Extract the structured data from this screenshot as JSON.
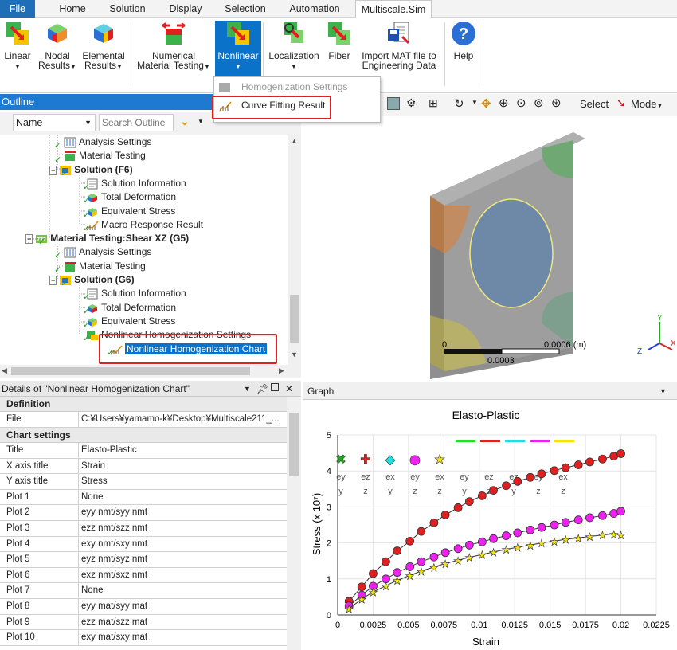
{
  "ribbon_tabs": [
    "File",
    "Home",
    "Solution",
    "Display",
    "Selection",
    "Automation",
    "Multiscale.Sim"
  ],
  "ribbon_buttons": {
    "linear": "Linear",
    "nodal_1": "Nodal",
    "nodal_2": "Results",
    "elemental_1": "Elemental",
    "elemental_2": "Results",
    "numerical_1": "Numerical",
    "numerical_2": "Material Testing",
    "nonlinear": "Nonlinear",
    "localization": "Localization",
    "fiber": "Fiber",
    "import_1": "Import MAT file to",
    "import_2": "Engineering Data",
    "help": "Help"
  },
  "dropdown": {
    "item1": "Homogenization Settings",
    "item2": "Curve Fitting Result"
  },
  "outline": {
    "title": "Outline",
    "name_label": "Name",
    "search_placeholder": "Search Outline",
    "tree": [
      "Analysis Settings",
      "Material Testing",
      "Solution (F6)",
      "Solution Information",
      "Total Deformation",
      "Equivalent Stress",
      "Macro Response Result",
      "Material Testing:Shear XZ (G5)",
      "Analysis Settings",
      "Material Testing",
      "Solution (G6)",
      "Solution Information",
      "Total Deformation",
      "Equivalent Stress",
      "Nonlinear Homogenization Settings",
      "Nonlinear Homogenization Chart"
    ]
  },
  "details": {
    "title": "Details of \"Nonlinear Homogenization Chart\"",
    "section_definition": "Definition",
    "file_key": "File",
    "file_value": "C:¥Users¥yamamo-k¥Desktop¥Multiscale211_...",
    "section_chart": "Chart settings",
    "rows": [
      {
        "k": "Title",
        "v": "Elasto-Plastic"
      },
      {
        "k": "X axis title",
        "v": "Strain"
      },
      {
        "k": "Y axis title",
        "v": "Stress"
      },
      {
        "k": "Plot 1",
        "v": "None"
      },
      {
        "k": "Plot 2",
        "v": "eyy nmt/syy nmt"
      },
      {
        "k": "Plot 3",
        "v": "ezz nmt/szz nmt"
      },
      {
        "k": "Plot 4",
        "v": "exy nmt/sxy nmt"
      },
      {
        "k": "Plot 5",
        "v": "eyz nmt/syz nmt"
      },
      {
        "k": "Plot 6",
        "v": "exz nmt/sxz nmt"
      },
      {
        "k": "Plot 7",
        "v": "None"
      },
      {
        "k": "Plot 8",
        "v": "eyy mat/syy mat"
      },
      {
        "k": "Plot 9",
        "v": "ezz mat/szz mat"
      },
      {
        "k": "Plot 10",
        "v": "exy mat/sxy mat"
      }
    ]
  },
  "viewport": {
    "select_label": "Select",
    "mode_label": "Mode",
    "scale_max": "0.0006 (m)",
    "scale_mid": "0.0003",
    "scale_zero": "0",
    "axis_x": "X",
    "axis_y": "Y",
    "axis_z": "Z"
  },
  "graph": {
    "panel_title": "Graph",
    "legend_labels": [
      "ey",
      "ez",
      "ex",
      "ey",
      "ex",
      "ey",
      "ez",
      "ez",
      "ey",
      "ex"
    ],
    "legend_labels_2": [
      "y",
      "z",
      "y",
      "z",
      "z",
      "y",
      "z",
      "y",
      "z",
      "z"
    ]
  },
  "chart_data": {
    "type": "scatter",
    "title": "Elasto-Plastic",
    "xlabel": "Strain",
    "ylabel": "Stress (x 10⁷)",
    "xlim": [
      0,
      0.0225
    ],
    "ylim": [
      0,
      5
    ],
    "xticks": [
      "0",
      "0.0025",
      "0.005",
      "0.0075",
      "0.01",
      "0.0125",
      "0.015",
      "0.0175",
      "0.02",
      "0.0225"
    ],
    "yticks": [
      "0",
      "1",
      "2",
      "3",
      "4",
      "5"
    ],
    "grid": true,
    "series": [
      {
        "marker": "circle",
        "color": "#e02020",
        "x": [
          0.0008,
          0.0017,
          0.0025,
          0.0034,
          0.0042,
          0.0051,
          0.0059,
          0.0068,
          0.0076,
          0.0085,
          0.0093,
          0.0102,
          0.011,
          0.0119,
          0.0127,
          0.0136,
          0.0144,
          0.0153,
          0.0161,
          0.017,
          0.0178,
          0.0187,
          0.0195,
          0.02
        ],
        "y": [
          0.38,
          0.78,
          1.15,
          1.48,
          1.78,
          2.05,
          2.32,
          2.56,
          2.78,
          2.98,
          3.15,
          3.31,
          3.46,
          3.59,
          3.71,
          3.82,
          3.92,
          4.01,
          4.09,
          4.17,
          4.25,
          4.33,
          4.41,
          4.48
        ]
      },
      {
        "marker": "circle",
        "color": "#ee22ee",
        "x": [
          0.0008,
          0.0017,
          0.0025,
          0.0034,
          0.0042,
          0.0051,
          0.0059,
          0.0068,
          0.0076,
          0.0085,
          0.0093,
          0.0102,
          0.011,
          0.0119,
          0.0127,
          0.0136,
          0.0144,
          0.0153,
          0.0161,
          0.017,
          0.0178,
          0.0187,
          0.0195,
          0.02
        ],
        "y": [
          0.25,
          0.55,
          0.8,
          1.0,
          1.18,
          1.34,
          1.48,
          1.61,
          1.73,
          1.84,
          1.94,
          2.03,
          2.12,
          2.2,
          2.28,
          2.36,
          2.43,
          2.5,
          2.57,
          2.64,
          2.7,
          2.76,
          2.82,
          2.88
        ]
      },
      {
        "marker": "star",
        "color": "#f2e600",
        "x": [
          0.0008,
          0.0017,
          0.0025,
          0.0034,
          0.0042,
          0.0051,
          0.0059,
          0.0068,
          0.0076,
          0.0085,
          0.0093,
          0.0102,
          0.011,
          0.0119,
          0.0127,
          0.0136,
          0.0144,
          0.0153,
          0.0161,
          0.017,
          0.0178,
          0.0187,
          0.0195,
          0.02
        ],
        "y": [
          0.18,
          0.44,
          0.64,
          0.81,
          0.96,
          1.1,
          1.22,
          1.33,
          1.43,
          1.52,
          1.6,
          1.68,
          1.75,
          1.82,
          1.88,
          1.94,
          2.0,
          2.05,
          2.1,
          2.14,
          2.18,
          2.22,
          2.25,
          2.22
        ]
      }
    ],
    "legend_swatches": [
      "#22dd22",
      "#e02020",
      "#22dddd",
      "#ee22ee",
      "#f2e600"
    ]
  }
}
